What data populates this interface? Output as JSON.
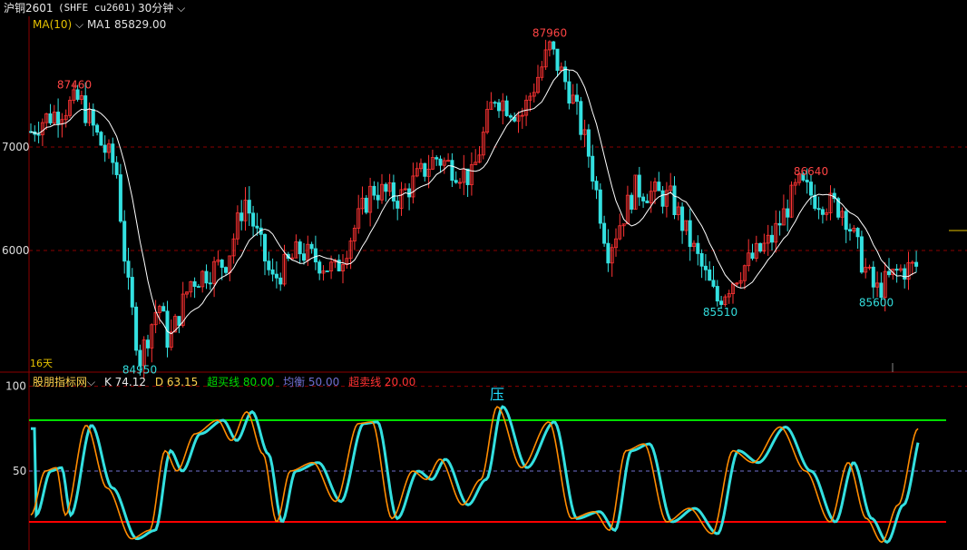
{
  "header": {
    "title": "沪铜2601",
    "subtitle": "(SHFE cu2601)",
    "period": "30分钟"
  },
  "ma": {
    "name": "MA(10)",
    "value": "MA1 85829.00"
  },
  "indicator": {
    "name": "股朋指标网",
    "k": "K 74.12",
    "d": "D 63.15",
    "overbought": "超买线 80.00",
    "balance": "均衡 50.00",
    "oversold": "超卖线 20.00",
    "pressure_mark": "压"
  },
  "price_axis": {
    "tick_87000": "7000",
    "tick_86000": "6000"
  },
  "kd_axis": {
    "tick_100": "100",
    "tick_50": "50"
  },
  "price_annotations": {
    "p1": "87460",
    "p2": "84950",
    "p3": "87960",
    "p4": "86640",
    "p5": "85510",
    "p6": "85600",
    "days": "16天"
  },
  "colors": {
    "up": "#ff3333",
    "down": "#33e0e0",
    "grid": "#8b0000",
    "ma": "#ffffff",
    "overbought": "#00dd00",
    "oversold": "#ff0000",
    "balance": "#6f6fd0",
    "k_line": "#ff8c00"
  },
  "chart_data": [
    {
      "type": "line",
      "title": "沪铜2601 30分钟",
      "ylim": [
        84700,
        88300
      ],
      "ticks": [
        86000,
        87000
      ],
      "key_points": [
        {
          "label": "87460",
          "value": 87460
        },
        {
          "label": "84950",
          "value": 84950
        },
        {
          "label": "87960",
          "value": 87960
        },
        {
          "label": "86640",
          "value": 86640
        },
        {
          "label": "85510",
          "value": 85510
        },
        {
          "label": "85600",
          "value": 85600
        }
      ],
      "series": [
        {
          "name": "MA1",
          "last": 85829.0
        }
      ]
    },
    {
      "type": "line",
      "title": "股朋指标网",
      "ylim": [
        0,
        100
      ],
      "lines": {
        "overbought": 80,
        "balance": 50,
        "oversold": 20
      },
      "series": [
        {
          "name": "K",
          "last": 74.12
        },
        {
          "name": "D",
          "last": 63.15
        }
      ]
    }
  ]
}
